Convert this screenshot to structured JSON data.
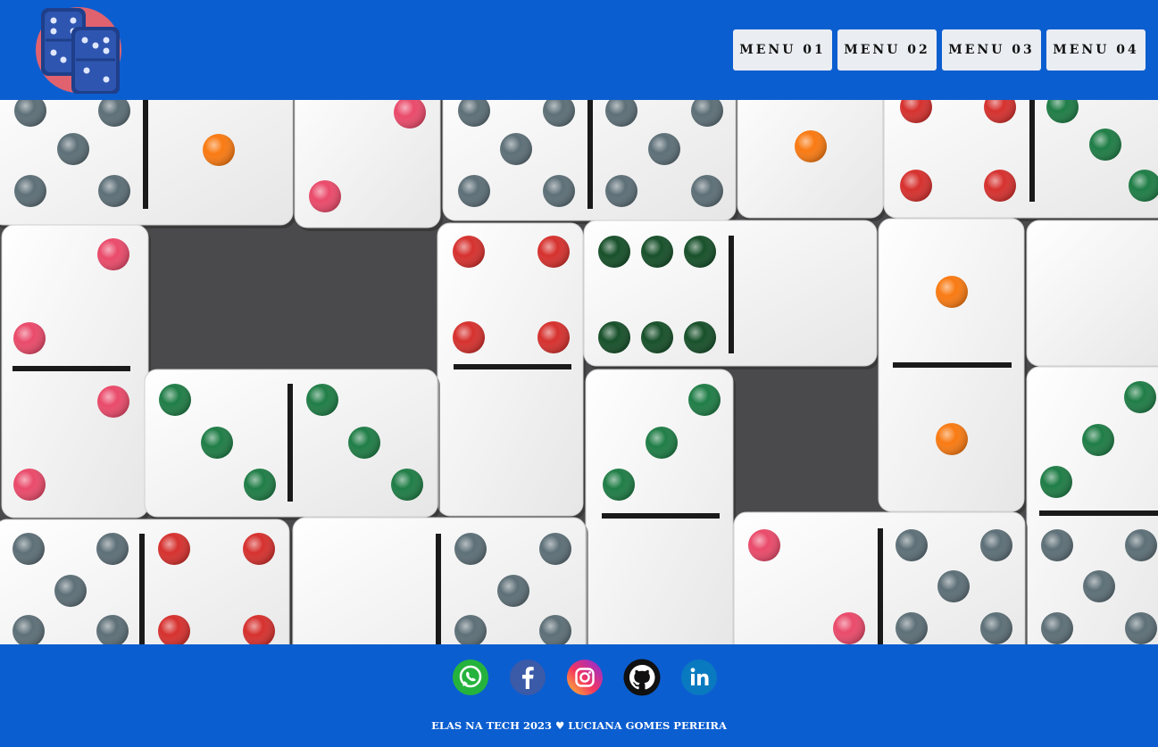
{
  "header": {
    "logo_icon": "domino-tiles-icon",
    "menu": [
      {
        "label": "MENU 01"
      },
      {
        "label": "MENU 02"
      },
      {
        "label": "MENU 03"
      },
      {
        "label": "MENU 04"
      }
    ]
  },
  "hero": {
    "image": "domino-tiles-photo"
  },
  "footer": {
    "socials": [
      {
        "name": "whatsapp-icon"
      },
      {
        "name": "facebook-icon"
      },
      {
        "name": "instagram-icon"
      },
      {
        "name": "github-icon"
      },
      {
        "name": "linkedin-icon"
      }
    ],
    "credit": "ELAS NA TECH 2023 ♥ LUCIANA GOMES PEREIRA"
  },
  "colors": {
    "brand_blue": "#0b5ed0",
    "menu_bg": "#eaedf2",
    "logo_circle": "#e0626f",
    "logo_tile": "#2a4ea0"
  }
}
